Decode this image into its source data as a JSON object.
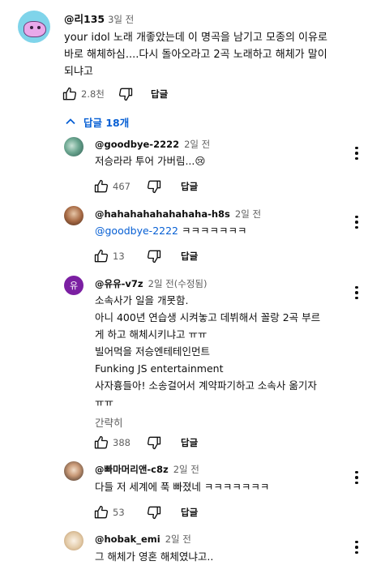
{
  "top_comment": {
    "author": "@리135",
    "time": "3일 전",
    "lines": [
      "your idol 노래 개좋았는데 이 명곡을 남기고 모종의 이유로",
      "바로 해체하심....다시 돌아오라고 2곡 노래하고 해체가 말이",
      "되냐고"
    ],
    "like_count": "2.8천",
    "reply_label": "답글"
  },
  "replies_toggle": {
    "label": "답글 18개",
    "icon": "chevron-up-icon",
    "color": "#065fd4"
  },
  "replies": [
    {
      "author": "@goodbye-2222",
      "time": "2일 전",
      "lines": [
        "저승라라 투어 가버림...😢"
      ],
      "like_count": "467",
      "reply_label": "답글"
    },
    {
      "author": "@hahahahahahahaha-h8s",
      "time": "2일 전",
      "mention": "@goodbye-2222",
      "lines": [
        "ㅋㅋㅋㅋㅋㅋㅋ"
      ],
      "like_count": "13",
      "reply_label": "답글"
    },
    {
      "author": "@유유-v7z",
      "time": "2일 전(수정됨)",
      "avatar_letter": "유",
      "lines": [
        "소속사가 일을 개못함.",
        "아니 400년 연습생 시켜놓고 데뷔해서 꼴랑 2곡 부르",
        "게 하고 해체시키냐고 ㅠㅠ",
        "빌어먹을 저승엔테테인먼트",
        "Funking JS entertainment",
        "사자흉들아! 소송걸어서 계약파기하고 소속사 옮기자",
        "ㅠㅠ"
      ],
      "expand_label": "간략히",
      "like_count": "388",
      "reply_label": "답글"
    },
    {
      "author": "@빠마머리앤-c8z",
      "time": "2일 전",
      "lines": [
        "다들 저 세계에 푹 빠졌네 ㅋㅋㅋㅋㅋㅋㅋ"
      ],
      "like_count": "53",
      "reply_label": "답글"
    },
    {
      "author": "@hobak_emi",
      "time": "2일 전",
      "lines": [
        "그 해체가 영혼 해체였냐고.."
      ]
    }
  ]
}
